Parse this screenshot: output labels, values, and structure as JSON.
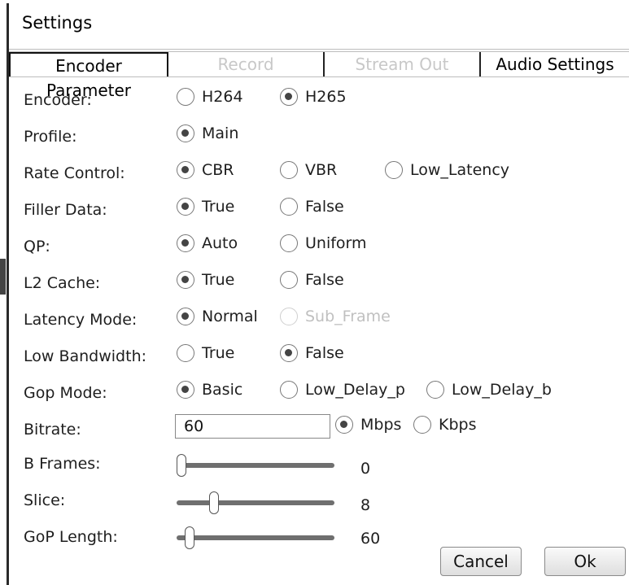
{
  "window": {
    "title": "Settings"
  },
  "tabs": [
    {
      "label": "Encoder Parameter",
      "state": "active"
    },
    {
      "label": "Record",
      "state": "disabled"
    },
    {
      "label": "Stream Out",
      "state": "disabled"
    },
    {
      "label": "Audio Settings",
      "state": "normal"
    }
  ],
  "encoder": {
    "label": "Encoder:",
    "options": [
      "H264",
      "H265"
    ],
    "selected": "H265"
  },
  "profile": {
    "label": "Profile:",
    "options": [
      "Main"
    ],
    "selected": "Main"
  },
  "rate_control": {
    "label": "Rate Control:",
    "options": [
      "CBR",
      "VBR",
      "Low_Latency"
    ],
    "selected": "CBR"
  },
  "filler_data": {
    "label": "Filler Data:",
    "options": [
      "True",
      "False"
    ],
    "selected": "True"
  },
  "qp": {
    "label": "QP:",
    "options": [
      "Auto",
      "Uniform"
    ],
    "selected": "Auto"
  },
  "l2_cache": {
    "label": "L2 Cache:",
    "options": [
      "True",
      "False"
    ],
    "selected": "True"
  },
  "latency_mode": {
    "label": "Latency Mode:",
    "options": [
      "Normal",
      "Sub_Frame"
    ],
    "selected": "Normal",
    "disabled_option": "Sub_Frame"
  },
  "low_bandwidth": {
    "label": "Low Bandwidth:",
    "options": [
      "True",
      "False"
    ],
    "selected": "False"
  },
  "gop_mode": {
    "label": "Gop Mode:",
    "options": [
      "Basic",
      "Low_Delay_p",
      "Low_Delay_b"
    ],
    "selected": "Basic"
  },
  "bitrate": {
    "label": "Bitrate:",
    "value": "60",
    "units": [
      "Mbps",
      "Kbps"
    ],
    "selected_unit": "Mbps"
  },
  "b_frames": {
    "label": "B Frames:",
    "value": "0"
  },
  "slice": {
    "label": "Slice:",
    "value": "8"
  },
  "gop_length": {
    "label": "GoP Length:",
    "value": "60"
  },
  "buttons": {
    "cancel": "Cancel",
    "ok": "Ok"
  }
}
